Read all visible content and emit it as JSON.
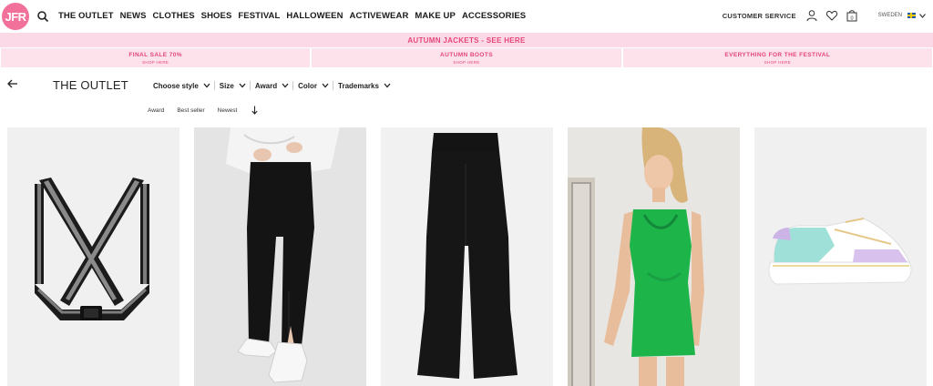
{
  "header": {
    "logo_text": "JFR",
    "nav": [
      "THE OUTLET",
      "NEWS",
      "CLOTHES",
      "SHOES",
      "FESTIVAL",
      "HALLOWEEN",
      "ACTIVEWEAR",
      "MAKE UP",
      "ACCESSORIES"
    ],
    "customer_service": "CUSTOMER SERVICE",
    "cart_count": "0",
    "region": "SWEDEN"
  },
  "promo": {
    "main": "AUTUMN JACKETS - SEE HERE",
    "cells": [
      {
        "title": "FINAL SALE 70%",
        "sub": "SHOP HERE"
      },
      {
        "title": "AUTUMN BOOTS",
        "sub": "SHOP HERE"
      },
      {
        "title": "EVERYTHING FOR THE FESTIVAL",
        "sub": "SHOP HERE"
      }
    ]
  },
  "page": {
    "title": "THE OUTLET",
    "filters": [
      "Choose style",
      "Size",
      "Award",
      "Color",
      "Trademarks"
    ],
    "sorts": [
      "Award",
      "Best seller",
      "Newest"
    ]
  },
  "products": [
    {
      "name": "reflective-harness",
      "bg": "#efefef"
    },
    {
      "name": "black-split-trousers",
      "bg": "#e6e6e6"
    },
    {
      "name": "black-flared-trousers",
      "bg": "#efefef"
    },
    {
      "name": "green-satin-dress",
      "bg": "#e9e7e4"
    },
    {
      "name": "pastel-sneaker",
      "bg": "#efefef"
    }
  ],
  "colors": {
    "brand": "#f2719b",
    "promo_text": "#e5467a",
    "promo_bg": "#fcd9e6"
  }
}
